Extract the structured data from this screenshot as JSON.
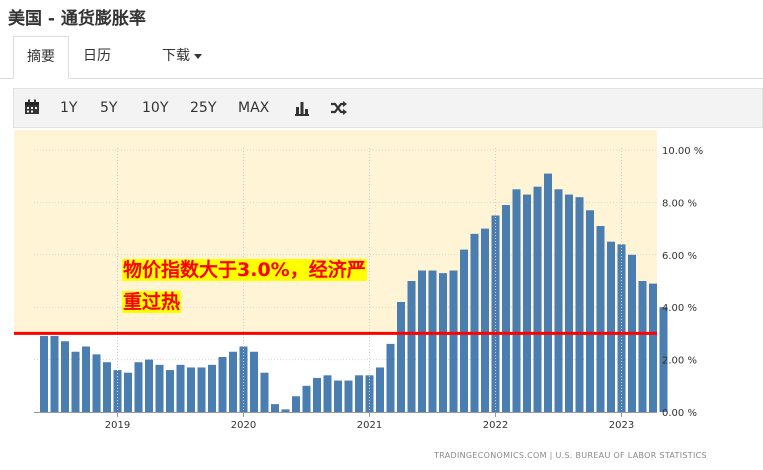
{
  "page": {
    "title": "美国 - 通货膨胀率"
  },
  "tabs": [
    {
      "label": "摘要",
      "active": true
    },
    {
      "label": "日历",
      "active": false
    },
    {
      "label": "下载",
      "active": false
    }
  ],
  "toolbar": {
    "ranges": [
      "1Y",
      "5Y",
      "10Y",
      "25Y",
      "MAX"
    ],
    "icons": [
      "calendar-icon",
      "bar-chart-icon",
      "shuffle-icon"
    ]
  },
  "annotation": {
    "line1": "物价指数大于3.0%，经济严",
    "line2": "重过热"
  },
  "source": "TRADINGECONOMICS.COM  |  U.S. BUREAU OF LABOR STATISTICS",
  "colors": {
    "bar": "#4a7db0",
    "highlight_bg": "#fff5d6",
    "threshold_line": "#ff0000",
    "annotation_text": "#ff0000",
    "annotation_bg": "#ffff00"
  },
  "chart_data": {
    "type": "bar",
    "title": "",
    "xlabel": "",
    "ylabel": "",
    "unit": "%",
    "ylim": [
      0,
      10
    ],
    "yticks": [
      "0.00 %",
      "2.00 %",
      "4.00 %",
      "6.00 %",
      "8.00 %",
      "10.00 %"
    ],
    "xticks": [
      "2019",
      "2020",
      "2021",
      "2022",
      "2023"
    ],
    "threshold": 3.0,
    "categories": [
      "2018-06",
      "2018-07",
      "2018-08",
      "2018-09",
      "2018-10",
      "2018-11",
      "2018-12",
      "2019-01",
      "2019-02",
      "2019-03",
      "2019-04",
      "2019-05",
      "2019-06",
      "2019-07",
      "2019-08",
      "2019-09",
      "2019-10",
      "2019-11",
      "2019-12",
      "2020-01",
      "2020-02",
      "2020-03",
      "2020-04",
      "2020-05",
      "2020-06",
      "2020-07",
      "2020-08",
      "2020-09",
      "2020-10",
      "2020-11",
      "2020-12",
      "2021-01",
      "2021-02",
      "2021-03",
      "2021-04",
      "2021-05",
      "2021-06",
      "2021-07",
      "2021-08",
      "2021-09",
      "2021-10",
      "2021-11",
      "2021-12",
      "2022-01",
      "2022-02",
      "2022-03",
      "2022-04",
      "2022-05",
      "2022-06",
      "2022-07",
      "2022-08",
      "2022-09",
      "2022-10",
      "2022-11",
      "2022-12",
      "2023-01",
      "2023-02",
      "2023-03",
      "2023-04",
      "2023-05"
    ],
    "values": [
      2.9,
      2.9,
      2.7,
      2.3,
      2.5,
      2.2,
      1.9,
      1.6,
      1.5,
      1.9,
      2.0,
      1.8,
      1.6,
      1.8,
      1.7,
      1.7,
      1.8,
      2.1,
      2.3,
      2.5,
      2.3,
      1.5,
      0.3,
      0.1,
      0.6,
      1.0,
      1.3,
      1.4,
      1.2,
      1.2,
      1.4,
      1.4,
      1.7,
      2.6,
      4.2,
      5.0,
      5.4,
      5.4,
      5.3,
      5.4,
      6.2,
      6.8,
      7.0,
      7.5,
      7.9,
      8.5,
      8.3,
      8.6,
      9.1,
      8.5,
      8.3,
      8.2,
      7.7,
      7.1,
      6.5,
      6.4,
      6.0,
      5.0,
      4.9,
      4.0
    ]
  }
}
